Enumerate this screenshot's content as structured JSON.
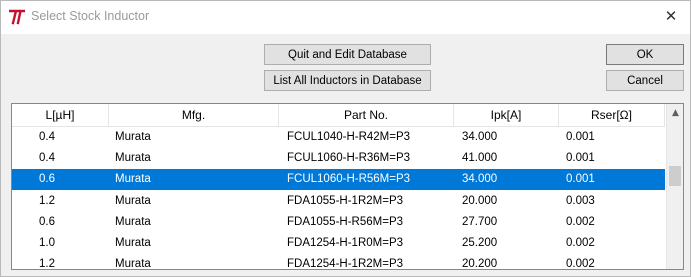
{
  "window": {
    "title": "Select Stock Inductor"
  },
  "buttons": {
    "quit_edit": "Quit and Edit Database",
    "list_all": "List All Inductors in Database",
    "ok": "OK",
    "cancel": "Cancel"
  },
  "table": {
    "columns": [
      "L[µH]",
      "Mfg.",
      "Part No.",
      "Ipk[A]",
      "Rser[Ω]"
    ],
    "rows": [
      {
        "l": "0.4",
        "mfg": "Murata",
        "part": "FCUL1040-H-R42M=P3",
        "ipk": "34.000",
        "rser": "0.001",
        "selected": false
      },
      {
        "l": "0.4",
        "mfg": "Murata",
        "part": "FCUL1060-H-R36M=P3",
        "ipk": "41.000",
        "rser": "0.001",
        "selected": false
      },
      {
        "l": "0.6",
        "mfg": "Murata",
        "part": "FCUL1060-H-R56M=P3",
        "ipk": "34.000",
        "rser": "0.001",
        "selected": true
      },
      {
        "l": "1.2",
        "mfg": "Murata",
        "part": "FDA1055-H-1R2M=P3",
        "ipk": "20.000",
        "rser": "0.003",
        "selected": false
      },
      {
        "l": "0.6",
        "mfg": "Murata",
        "part": "FDA1055-H-R56M=P3",
        "ipk": "27.700",
        "rser": "0.002",
        "selected": false
      },
      {
        "l": "1.0",
        "mfg": "Murata",
        "part": "FDA1254-H-1R0M=P3",
        "ipk": "25.200",
        "rser": "0.002",
        "selected": false
      },
      {
        "l": "1.2",
        "mfg": "Murata",
        "part": "FDA1254-H-1R2M=P3",
        "ipk": "20.200",
        "rser": "0.002",
        "selected": false
      }
    ]
  },
  "colors": {
    "selection": "#0078d7",
    "app_icon": "#c8102e"
  },
  "icons": {
    "app": "ltspice-icon",
    "close": "close-icon",
    "scroll_up": "scroll-up-arrow-icon"
  }
}
